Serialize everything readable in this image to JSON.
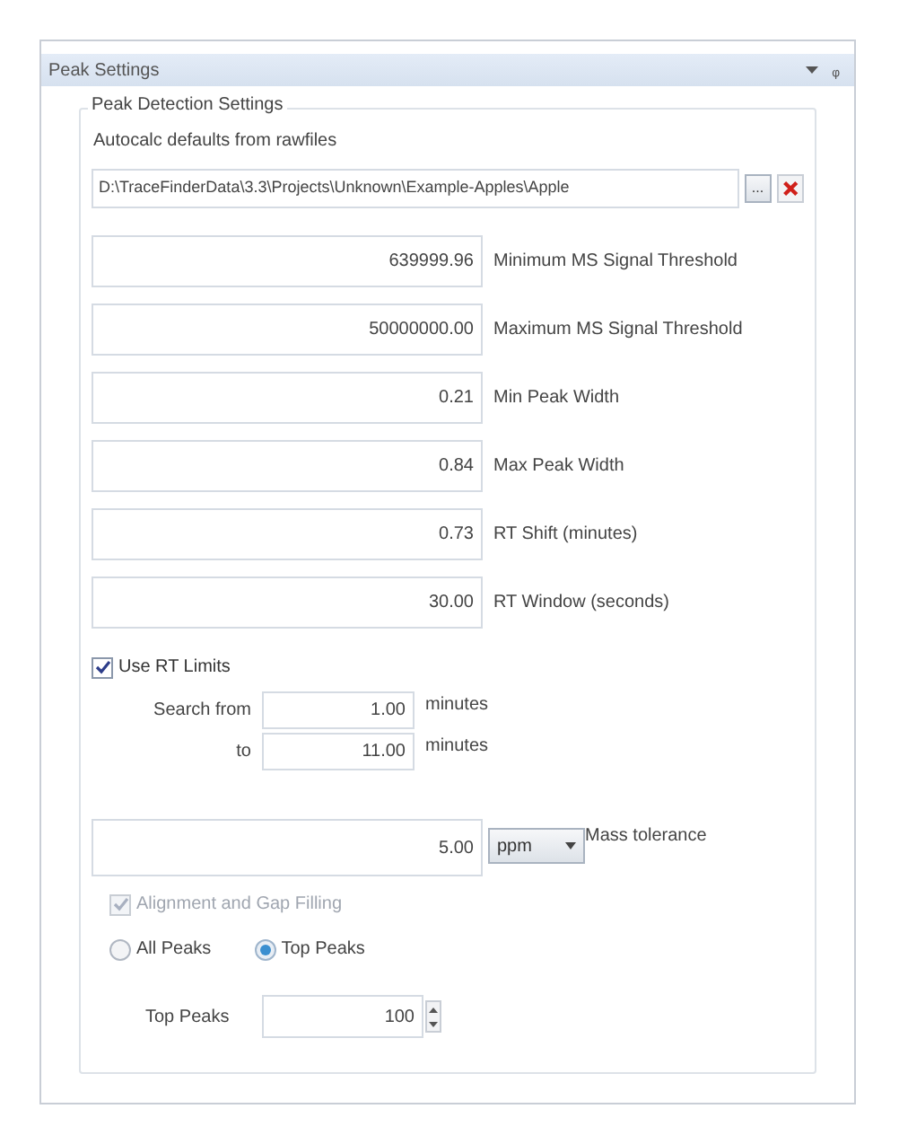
{
  "panel": {
    "title": "Peak Settings",
    "pin_icon": "ᵩ"
  },
  "group": {
    "title": "Peak Detection Settings"
  },
  "autocalc": {
    "label": "Autocalc defaults from rawfiles",
    "path": "D:\\TraceFinderData\\3.3\\Projects\\Unknown\\Example-Apples\\Apple",
    "browse": "..."
  },
  "fields": [
    {
      "value": "639999.96",
      "label": "Minimum MS Signal Threshold"
    },
    {
      "value": "50000000.00",
      "label": "Maximum MS Signal Threshold"
    },
    {
      "value": "0.21",
      "label": "Min Peak Width"
    },
    {
      "value": "0.84",
      "label": "Max Peak Width"
    },
    {
      "value": "0.73",
      "label": "RT Shift (minutes)"
    },
    {
      "value": "30.00",
      "label": "RT Window (seconds)"
    }
  ],
  "rt_limits": {
    "label": "Use RT Limits",
    "checked": true,
    "rows": [
      {
        "label": "Search from",
        "value": "1.00",
        "unit": "minutes"
      },
      {
        "label": "to",
        "value": "11.00",
        "unit": "minutes"
      }
    ]
  },
  "mass_tolerance": {
    "value": "5.00",
    "unit": "ppm",
    "label": "Mass tolerance"
  },
  "alignment": {
    "label": "Alignment and Gap Filling",
    "checked": true,
    "disabled": true
  },
  "peak_mode": [
    {
      "label": "All Peaks",
      "selected": false
    },
    {
      "label": "Top Peaks",
      "selected": true
    }
  ],
  "top_peaks": {
    "label": "Top Peaks",
    "value": "100"
  }
}
